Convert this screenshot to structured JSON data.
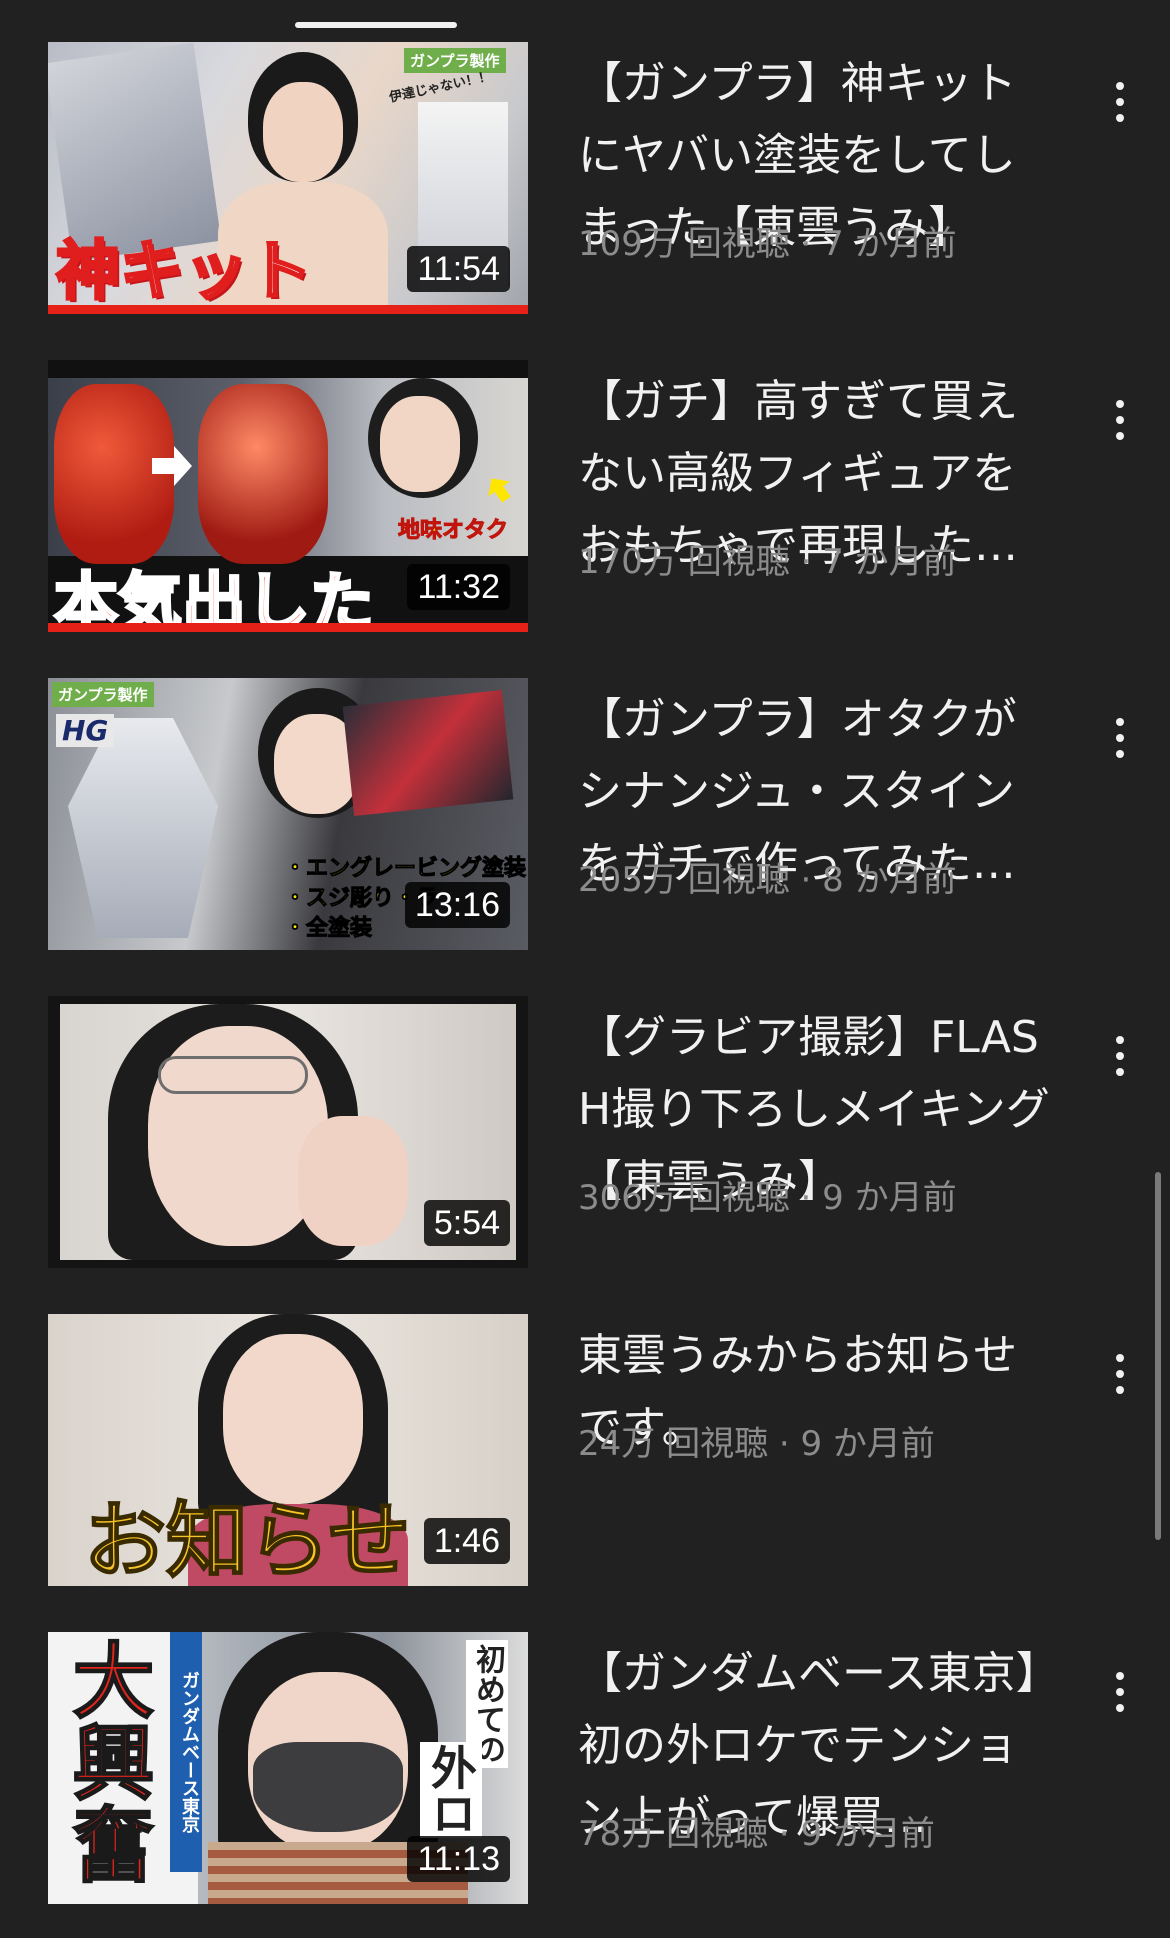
{
  "videos": [
    {
      "title": "【ガンプラ】神キットにヤバい塗装をしてしまった【東雲うみ】",
      "stats": "109万 回視聴 · 7 か月前",
      "duration": "11:54",
      "progress": 1.0,
      "thumb_text": {
        "main": "神キット",
        "tag": "ガンプラ製作",
        "bubble": "伊達じゃない！！"
      }
    },
    {
      "title": "【ガチ】高すぎて買えない高級フィギュアをおもちゃで再現した…",
      "stats": "170万 回視聴 · 7 か月前",
      "duration": "11:32",
      "progress": 1.0,
      "thumb_text": {
        "main": "本気出した",
        "tag": "地味オタク"
      }
    },
    {
      "title": "【ガンプラ】オタクがシナンジュ・スタインをガチで作ってみた…",
      "stats": "205万 回視聴 · 8 か月前",
      "duration": "13:16",
      "progress": 0,
      "thumb_text": {
        "tag": "ガンプラ製作",
        "badge": "HG",
        "line1": "・エングレービング塗装",
        "line2": "・スジ彫り・ラ",
        "line3": "・全塗装"
      }
    },
    {
      "title": "【グラビア撮影】FLASH撮り下ろしメイキング【東雲うみ】",
      "stats": "306万 回視聴 · 9 か月前",
      "duration": "5:54",
      "progress": 0,
      "thumb_text": {}
    },
    {
      "title": "東雲うみからお知らせです。",
      "stats": "24万 回視聴 · 9 か月前",
      "duration": "1:46",
      "progress": 0,
      "thumb_text": {
        "main": "お知らせ"
      }
    },
    {
      "title": "【ガンダムベース東京】初の外ロケでテンション上がって爆買…",
      "stats": "78万 回視聴 · 9 か月前",
      "duration": "11:13",
      "progress": 0,
      "thumb_text": {
        "main": "大興奮",
        "tag": "ガンダムベース東京",
        "side": "初めての",
        "side2": "外ロ"
      }
    }
  ],
  "colors": {
    "background": "#212121",
    "title": "#f1f1f1",
    "stats": "#8c8c8c",
    "progress": "#e62117"
  },
  "icons": {
    "menu": "more-vert-icon",
    "handle": "drag-handle"
  }
}
